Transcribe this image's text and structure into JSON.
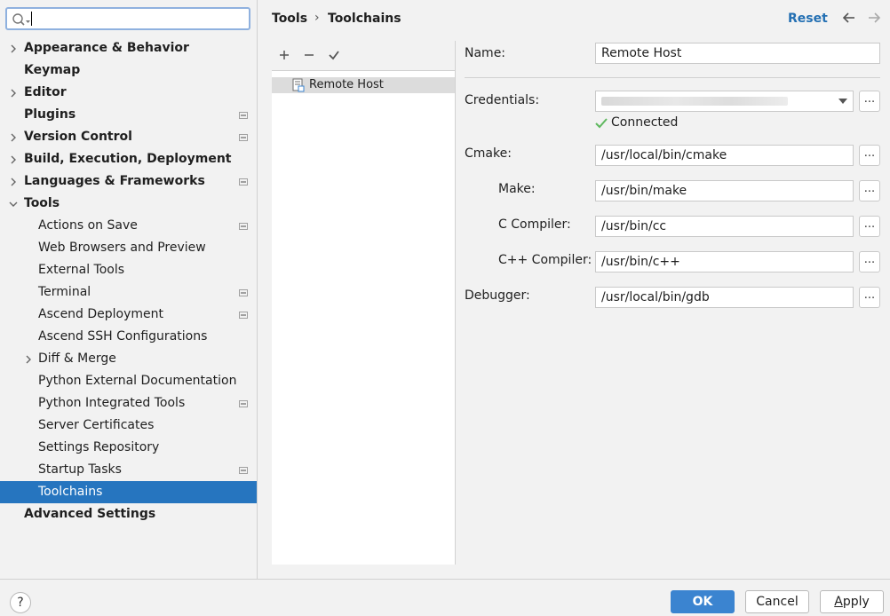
{
  "search": {
    "value": "",
    "placeholder": ""
  },
  "tree": [
    {
      "label": "Appearance & Behavior",
      "level": 0,
      "expandable": true,
      "expanded": false,
      "project": false
    },
    {
      "label": "Keymap",
      "level": 0,
      "expandable": false,
      "project": false
    },
    {
      "label": "Editor",
      "level": 0,
      "expandable": true,
      "expanded": false,
      "project": false
    },
    {
      "label": "Plugins",
      "level": 0,
      "expandable": false,
      "project": true
    },
    {
      "label": "Version Control",
      "level": 0,
      "expandable": true,
      "expanded": false,
      "project": true
    },
    {
      "label": "Build, Execution, Deployment",
      "level": 0,
      "expandable": true,
      "expanded": false,
      "project": false
    },
    {
      "label": "Languages & Frameworks",
      "level": 0,
      "expandable": true,
      "expanded": false,
      "project": true
    },
    {
      "label": "Tools",
      "level": 0,
      "expandable": true,
      "expanded": true,
      "project": false
    },
    {
      "label": "Actions on Save",
      "level": 1,
      "expandable": false,
      "project": true
    },
    {
      "label": "Web Browsers and Preview",
      "level": 1,
      "expandable": false,
      "project": false
    },
    {
      "label": "External Tools",
      "level": 1,
      "expandable": false,
      "project": false
    },
    {
      "label": "Terminal",
      "level": 1,
      "expandable": false,
      "project": true
    },
    {
      "label": "Ascend Deployment",
      "level": 1,
      "expandable": false,
      "project": true
    },
    {
      "label": "Ascend SSH Configurations",
      "level": 1,
      "expandable": false,
      "project": false
    },
    {
      "label": "Diff & Merge",
      "level": 1,
      "expandable": true,
      "expanded": false,
      "project": false
    },
    {
      "label": "Python External Documentation",
      "level": 1,
      "expandable": false,
      "project": false
    },
    {
      "label": "Python Integrated Tools",
      "level": 1,
      "expandable": false,
      "project": true
    },
    {
      "label": "Server Certificates",
      "level": 1,
      "expandable": false,
      "project": false
    },
    {
      "label": "Settings Repository",
      "level": 1,
      "expandable": false,
      "project": false
    },
    {
      "label": "Startup Tasks",
      "level": 1,
      "expandable": false,
      "project": true
    },
    {
      "label": "Toolchains",
      "level": 1,
      "expandable": false,
      "project": false,
      "selected": true
    },
    {
      "label": "Advanced Settings",
      "level": 0,
      "expandable": false,
      "project": false
    }
  ],
  "header": {
    "breadcrumb_parent": "Tools",
    "breadcrumb_sep": "›",
    "breadcrumb_current": "Toolchains",
    "reset_label": "Reset"
  },
  "toolchains": {
    "items": [
      {
        "label": "Remote Host"
      }
    ]
  },
  "form": {
    "name_label": "Name:",
    "name_value": "Remote Host",
    "credentials_label": "Credentials:",
    "status_text": "Connected",
    "cmake_label": "Cmake:",
    "cmake_value": "/usr/local/bin/cmake",
    "make_label": "Make:",
    "make_value": "/usr/bin/make",
    "c_compiler_label": "C Compiler:",
    "c_compiler_value": "/usr/bin/cc",
    "cpp_compiler_label": "C++ Compiler:",
    "cpp_compiler_value": "/usr/bin/c++",
    "debugger_label": "Debugger:",
    "debugger_value": "/usr/local/bin/gdb",
    "browse_label": "..."
  },
  "footer": {
    "help_label": "?",
    "ok_label": "OK",
    "cancel_label": "Cancel",
    "apply_label": "Apply"
  },
  "colors": {
    "selection": "#2675bf",
    "link": "#2470b3",
    "primary_button": "#3b84d0",
    "status_ok": "#5fb85f"
  }
}
